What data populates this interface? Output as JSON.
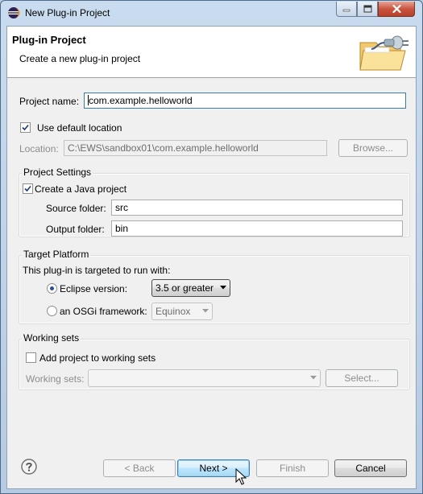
{
  "window": {
    "title": "New Plug-in Project",
    "controls": {
      "minimize": "minimize",
      "maximize": "maximize",
      "close": "close"
    }
  },
  "header": {
    "title": "Plug-in Project",
    "description": "Create a new plug-in project",
    "banner_icon": "folder-plugin-wizard-icon"
  },
  "project": {
    "name_label": "Project name:",
    "name_value": "com.example.helloworld",
    "use_default_label": "Use default location",
    "use_default_checked": true,
    "location_label": "Location:",
    "location_value": "C:\\EWS\\sandbox01\\com.example.helloworld",
    "browse_label": "Browse..."
  },
  "project_settings": {
    "title": "Project Settings",
    "create_java_label": "Create a Java project",
    "create_java_checked": true,
    "source_label": "Source folder:",
    "source_value": "src",
    "output_label": "Output folder:",
    "output_value": "bin"
  },
  "target_platform": {
    "title": "Target Platform",
    "intro": "This plug-in is targeted to run with:",
    "eclipse_label": "Eclipse version:",
    "eclipse_value": "3.5 or greater",
    "eclipse_selected": true,
    "osgi_label": "an OSGi framework:",
    "osgi_value": "Equinox"
  },
  "working_sets": {
    "title": "Working sets",
    "add_label": "Add project to working sets",
    "add_checked": false,
    "sets_label": "Working sets:",
    "sets_value": "",
    "select_label": "Select..."
  },
  "footer": {
    "help_icon": "help-icon",
    "back_label": "< Back",
    "next_label": "Next >",
    "finish_label": "Finish",
    "cancel_label": "Cancel"
  },
  "colors": {
    "title_bar": "#c9dcef",
    "close_button": "#c9553f",
    "dialog_bg": "#f0f0f0",
    "focus_border": "#3d7bad"
  }
}
